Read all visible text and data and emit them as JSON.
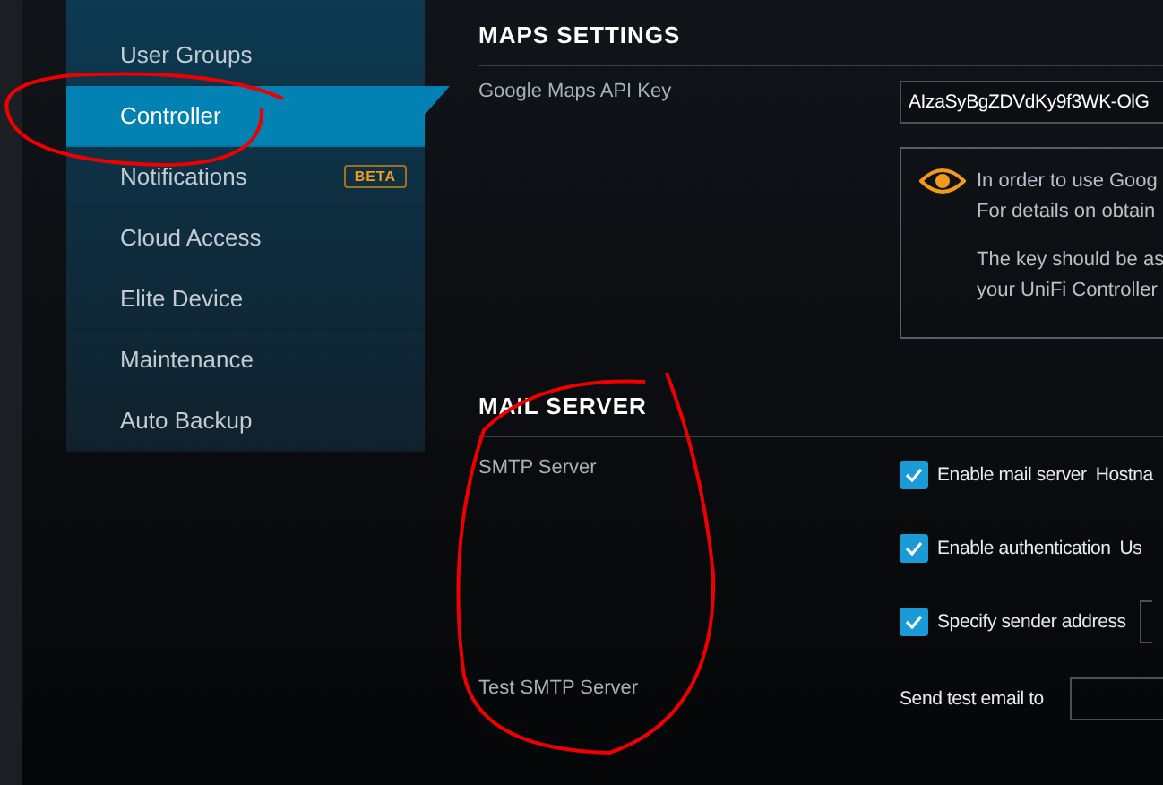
{
  "sidebar": {
    "items": [
      {
        "label": "User Groups",
        "selected": false
      },
      {
        "label": "Controller",
        "selected": true
      },
      {
        "label": "Notifications",
        "selected": false,
        "badge": "BETA"
      },
      {
        "label": "Cloud Access",
        "selected": false
      },
      {
        "label": "Elite Device",
        "selected": false
      },
      {
        "label": "Maintenance",
        "selected": false
      },
      {
        "label": "Auto Backup",
        "selected": false
      }
    ]
  },
  "maps_settings": {
    "title": "MAPS SETTINGS",
    "label": "Google Maps API Key",
    "api_key": "AIzaSyBgZDVdKy9f3WK-OlG",
    "info": [
      "In order to use Goog",
      "For details on obtain"
    ],
    "info_note": [
      "The key should be as",
      "your UniFi Controller"
    ]
  },
  "mail_server": {
    "title": "MAIL SERVER",
    "label": "SMTP Server",
    "options": [
      {
        "label": "Enable mail server",
        "checked": true,
        "trailing": "Hostna"
      },
      {
        "label": "Enable authentication",
        "checked": true,
        "trailing": "Us"
      },
      {
        "label": "Specify sender address",
        "checked": true,
        "field": true
      }
    ],
    "test_label": "Test SMTP Server",
    "test_field_label": "Send test email to"
  }
}
